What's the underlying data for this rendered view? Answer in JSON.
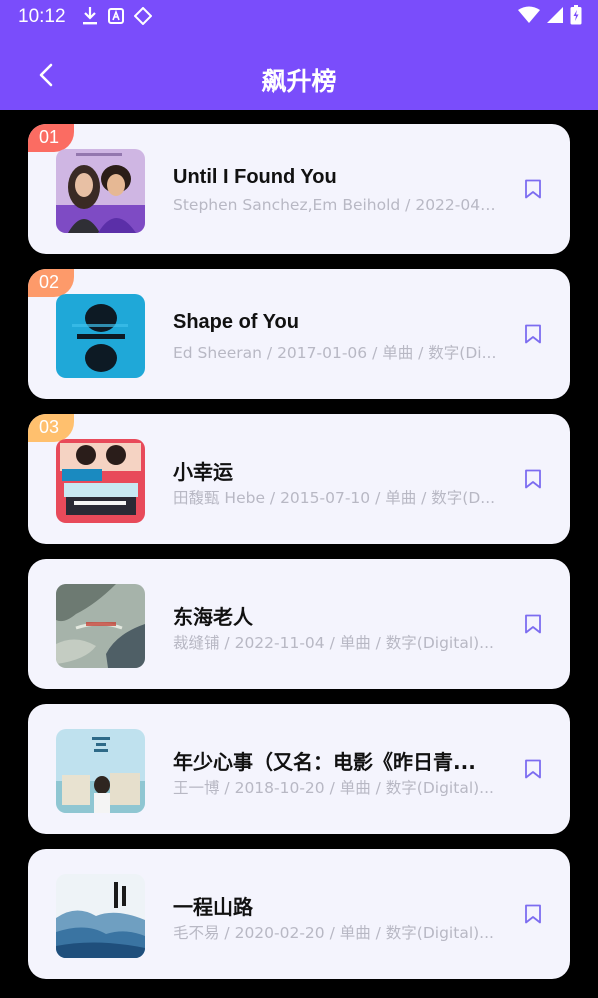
{
  "status_bar": {
    "time": "10:12"
  },
  "header": {
    "title": "飙升榜"
  },
  "colors": {
    "header_bg": "#7a4dfb",
    "rank_1": "#fb6c62",
    "rank_2": "#fd9a6a",
    "rank_3": "#ffc06e",
    "bookmark": "#7c6cf0"
  },
  "songs": [
    {
      "rank": "01",
      "title": "Until I Found You",
      "subtitle": "Stephen Sanchez,Em Beihold / 2022-04-2..."
    },
    {
      "rank": "02",
      "title": "Shape of You",
      "subtitle": "Ed Sheeran / 2017-01-06 / 单曲 / 数字(Di..."
    },
    {
      "rank": "03",
      "title": "小幸运",
      "subtitle": "田馥甄 Hebe / 2015-07-10 / 单曲 / 数字(D..."
    },
    {
      "rank": "",
      "title": "东海老人",
      "subtitle": "裁缝铺 / 2022-11-04 / 单曲 / 数字(Digital)..."
    },
    {
      "rank": "",
      "title": "年少心事（又名：电影《昨日青...",
      "subtitle": "王一博 / 2018-10-20 / 单曲 / 数字(Digital)..."
    },
    {
      "rank": "",
      "title": "一程山路",
      "subtitle": "毛不易 / 2020-02-20 / 单曲 / 数字(Digital)..."
    }
  ]
}
